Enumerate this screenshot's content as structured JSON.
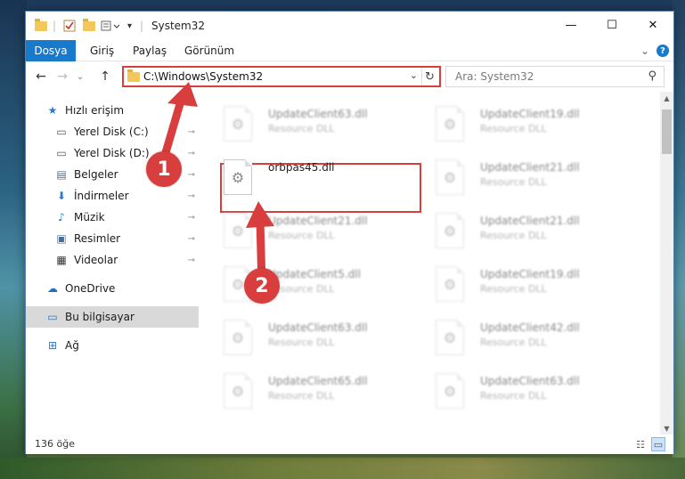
{
  "window": {
    "title": "System32",
    "minimize": "—",
    "maximize": "☐",
    "close": "✕"
  },
  "ribbon": {
    "tabs": [
      "Dosya",
      "Giriş",
      "Paylaş",
      "Görünüm"
    ],
    "help": "?",
    "collapse": "⌄"
  },
  "nav": {
    "back": "←",
    "forward": "→",
    "recent": "⌄",
    "up": "↑",
    "address": "C:\\Windows\\System32",
    "address_dropdown": "⌄",
    "refresh": "↻",
    "search_placeholder": "Ara: System32",
    "search_icon": "⚲"
  },
  "sidebar": {
    "items": [
      {
        "label": "Hızlı erişim",
        "icon": "star-icon",
        "glyph": "★",
        "color": "#2b79d0",
        "pinned": false,
        "indent": 0
      },
      {
        "label": "Yerel Disk (C:)",
        "icon": "drive-icon",
        "glyph": "▭",
        "color": "#5a5a5a",
        "pinned": true,
        "indent": 1
      },
      {
        "label": "Yerel Disk (D:)",
        "icon": "drive-icon",
        "glyph": "▭",
        "color": "#5a5a5a",
        "pinned": true,
        "indent": 1
      },
      {
        "label": "Belgeler",
        "icon": "documents-icon",
        "glyph": "▤",
        "color": "#5a6b85",
        "pinned": true,
        "indent": 1
      },
      {
        "label": "İndirmeler",
        "icon": "downloads-icon",
        "glyph": "⬇",
        "color": "#2b79d0",
        "pinned": true,
        "indent": 1
      },
      {
        "label": "Müzik",
        "icon": "music-icon",
        "glyph": "♪",
        "color": "#2b79d0",
        "pinned": true,
        "indent": 1
      },
      {
        "label": "Resimler",
        "icon": "pictures-icon",
        "glyph": "▣",
        "color": "#4a6d94",
        "pinned": true,
        "indent": 1
      },
      {
        "label": "Videolar",
        "icon": "videos-icon",
        "glyph": "▦",
        "color": "#333333",
        "pinned": true,
        "indent": 1
      },
      {
        "label": "OneDrive",
        "icon": "onedrive-icon",
        "glyph": "☁",
        "color": "#1a6fc9",
        "pinned": false,
        "indent": 0
      },
      {
        "label": "Bu bilgisayar",
        "icon": "computer-icon",
        "glyph": "▭",
        "color": "#2f77c7",
        "pinned": false,
        "indent": 0,
        "selected": true
      },
      {
        "label": "Ağ",
        "icon": "network-icon",
        "glyph": "⊞",
        "color": "#2f77c7",
        "pinned": false,
        "indent": 0
      }
    ],
    "pin_glyph": "📌"
  },
  "files": {
    "left_column": [
      {
        "name": "UpdateClient63.dll",
        "type": "Resource DLL",
        "blurred": true
      },
      {
        "name": "orbpas45.dll",
        "type": "",
        "blurred": false,
        "highlighted": true
      },
      {
        "name": "UpdateClient21.dll",
        "type": "Resource DLL",
        "blurred": true
      },
      {
        "name": "UpdateClient5.dll",
        "type": "Resource DLL",
        "blurred": true
      },
      {
        "name": "UpdateClient63.dll",
        "type": "Resource DLL",
        "blurred": true
      },
      {
        "name": "UpdateClient65.dll",
        "type": "Resource DLL",
        "blurred": true
      }
    ],
    "right_column": [
      {
        "name": "UpdateClient19.dll",
        "type": "Resource DLL",
        "blurred": true
      },
      {
        "name": "UpdateClient21.dll",
        "type": "Resource DLL",
        "blurred": true
      },
      {
        "name": "UpdateClient21.dll",
        "type": "Resource DLL",
        "blurred": true
      },
      {
        "name": "UpdateClient19.dll",
        "type": "Resource DLL",
        "blurred": true
      },
      {
        "name": "UpdateClient42.dll",
        "type": "Resource DLL",
        "blurred": true
      },
      {
        "name": "UpdateClient63.dll",
        "type": "Resource DLL",
        "blurred": true
      }
    ]
  },
  "status": {
    "count": "136 öğe"
  },
  "annotations": {
    "badge1": "1",
    "badge2": "2",
    "color": "#d93e3e"
  }
}
